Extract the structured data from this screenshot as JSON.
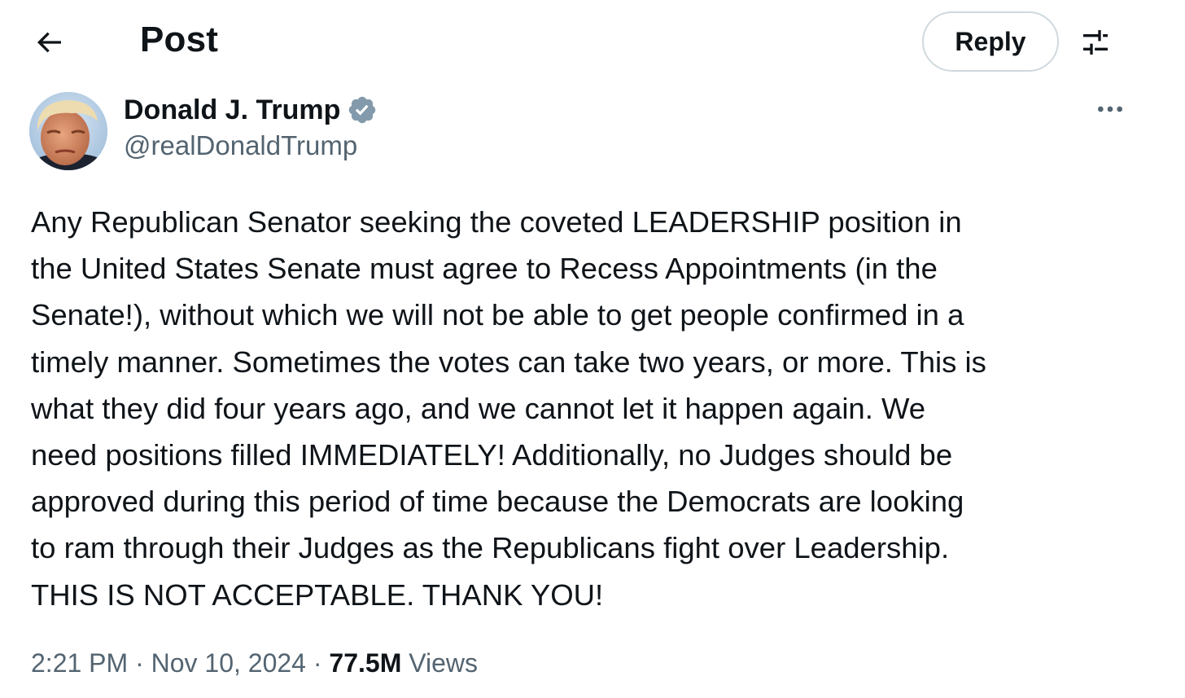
{
  "header": {
    "title": "Post",
    "reply_label": "Reply"
  },
  "icons": {
    "back": "arrow-left-icon",
    "settings": "sliders-icon",
    "verified": "verified-badge-icon",
    "more": "more-horizontal-icon"
  },
  "colors": {
    "text": "#0f1419",
    "secondary": "#536471",
    "border": "#cfd9de",
    "verified": "#829aab"
  },
  "author": {
    "name": "Donald J. Trump",
    "handle": "@realDonaldTrump"
  },
  "post": {
    "lines": [
      "Any Republican Senator seeking the coveted LEADERSHIP position in",
      "the United States Senate must agree to Recess Appointments (in the",
      "Senate!), without which we will not be able to get people confirmed in a",
      "timely manner. Sometimes the votes can take two years, or more. This is",
      "what they did four years ago, and we cannot let it happen again. We",
      "need positions filled IMMEDIATELY! Additionally, no Judges should be",
      "approved during this period of time because the Democrats are looking",
      "to ram through their Judges as the Republicans fight over Leadership.",
      "THIS IS NOT ACCEPTABLE. THANK YOU!"
    ]
  },
  "meta": {
    "time": "2:21 PM",
    "separator": " · ",
    "date": "Nov 10, 2024",
    "views_count": "77.5M",
    "views_label": " Views"
  }
}
